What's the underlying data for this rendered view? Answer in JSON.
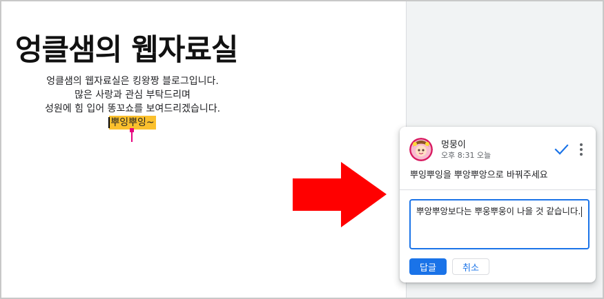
{
  "document": {
    "title": "엉클샘의 웹자료실",
    "body_lines": [
      "엉클샘의 웹자료실은 킹왕짱 블로그입니다.",
      "많은 사랑과 관심 부탁드리며",
      "성원에 힘 입어 똥꼬쇼를 보여드리겠습니다."
    ],
    "highlighted_text": "뿌잉뿌잉~"
  },
  "comment": {
    "author": "멍뭉이",
    "time": "오후 8:31 오늘",
    "text": "뿌잉뿌잉을 뿌앙뿌앙으로 바꿔주세요",
    "reply_draft": "뿌앙뿌앙보다는 뿌웅뿌웅이 나을 것 같습니다.",
    "reply_label": "답글",
    "cancel_label": "취소",
    "icons": {
      "avatar": "avatar-image",
      "resolve": "checkmark-icon",
      "more": "more-vert-icon"
    }
  },
  "colors": {
    "highlight": "#fbc02d",
    "anchor": "#e6007e",
    "accent": "#1a73e8",
    "arrow": "#ff0000"
  }
}
